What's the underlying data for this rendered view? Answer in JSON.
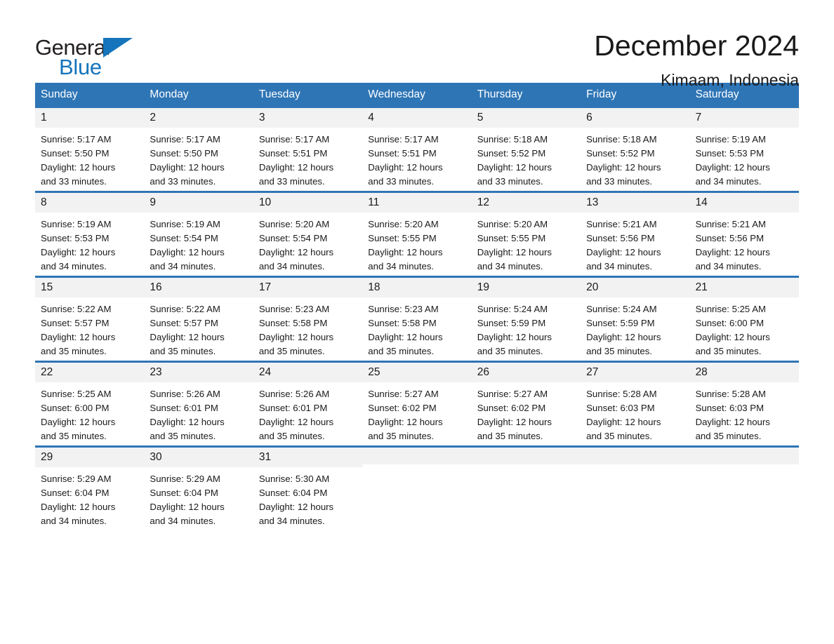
{
  "logo": {
    "word_one": "General",
    "word_two": "Blue",
    "triangle_color": "#1574bb",
    "text_color": "#231f20"
  },
  "header": {
    "title": "December 2024",
    "subtitle": "Kimaam, Indonesia"
  },
  "theme": {
    "header_blue": "#2e75b6",
    "date_band": "#f2f2f2",
    "text": "#1a1a1a",
    "page_background": "#ffffff"
  },
  "calendar": {
    "weekday_headers": [
      "Sunday",
      "Monday",
      "Tuesday",
      "Wednesday",
      "Thursday",
      "Friday",
      "Saturday"
    ],
    "labels": {
      "sunrise": "Sunrise:",
      "sunset": "Sunset:",
      "daylight": "Daylight:"
    },
    "weeks": [
      [
        {
          "date": "1",
          "sunrise": "Sunrise: 5:17 AM",
          "sunset": "Sunset: 5:50 PM",
          "daylight_line1": "Daylight: 12 hours",
          "daylight_line2": "and 33 minutes."
        },
        {
          "date": "2",
          "sunrise": "Sunrise: 5:17 AM",
          "sunset": "Sunset: 5:50 PM",
          "daylight_line1": "Daylight: 12 hours",
          "daylight_line2": "and 33 minutes."
        },
        {
          "date": "3",
          "sunrise": "Sunrise: 5:17 AM",
          "sunset": "Sunset: 5:51 PM",
          "daylight_line1": "Daylight: 12 hours",
          "daylight_line2": "and 33 minutes."
        },
        {
          "date": "4",
          "sunrise": "Sunrise: 5:17 AM",
          "sunset": "Sunset: 5:51 PM",
          "daylight_line1": "Daylight: 12 hours",
          "daylight_line2": "and 33 minutes."
        },
        {
          "date": "5",
          "sunrise": "Sunrise: 5:18 AM",
          "sunset": "Sunset: 5:52 PM",
          "daylight_line1": "Daylight: 12 hours",
          "daylight_line2": "and 33 minutes."
        },
        {
          "date": "6",
          "sunrise": "Sunrise: 5:18 AM",
          "sunset": "Sunset: 5:52 PM",
          "daylight_line1": "Daylight: 12 hours",
          "daylight_line2": "and 33 minutes."
        },
        {
          "date": "7",
          "sunrise": "Sunrise: 5:19 AM",
          "sunset": "Sunset: 5:53 PM",
          "daylight_line1": "Daylight: 12 hours",
          "daylight_line2": "and 34 minutes."
        }
      ],
      [
        {
          "date": "8",
          "sunrise": "Sunrise: 5:19 AM",
          "sunset": "Sunset: 5:53 PM",
          "daylight_line1": "Daylight: 12 hours",
          "daylight_line2": "and 34 minutes."
        },
        {
          "date": "9",
          "sunrise": "Sunrise: 5:19 AM",
          "sunset": "Sunset: 5:54 PM",
          "daylight_line1": "Daylight: 12 hours",
          "daylight_line2": "and 34 minutes."
        },
        {
          "date": "10",
          "sunrise": "Sunrise: 5:20 AM",
          "sunset": "Sunset: 5:54 PM",
          "daylight_line1": "Daylight: 12 hours",
          "daylight_line2": "and 34 minutes."
        },
        {
          "date": "11",
          "sunrise": "Sunrise: 5:20 AM",
          "sunset": "Sunset: 5:55 PM",
          "daylight_line1": "Daylight: 12 hours",
          "daylight_line2": "and 34 minutes."
        },
        {
          "date": "12",
          "sunrise": "Sunrise: 5:20 AM",
          "sunset": "Sunset: 5:55 PM",
          "daylight_line1": "Daylight: 12 hours",
          "daylight_line2": "and 34 minutes."
        },
        {
          "date": "13",
          "sunrise": "Sunrise: 5:21 AM",
          "sunset": "Sunset: 5:56 PM",
          "daylight_line1": "Daylight: 12 hours",
          "daylight_line2": "and 34 minutes."
        },
        {
          "date": "14",
          "sunrise": "Sunrise: 5:21 AM",
          "sunset": "Sunset: 5:56 PM",
          "daylight_line1": "Daylight: 12 hours",
          "daylight_line2": "and 34 minutes."
        }
      ],
      [
        {
          "date": "15",
          "sunrise": "Sunrise: 5:22 AM",
          "sunset": "Sunset: 5:57 PM",
          "daylight_line1": "Daylight: 12 hours",
          "daylight_line2": "and 35 minutes."
        },
        {
          "date": "16",
          "sunrise": "Sunrise: 5:22 AM",
          "sunset": "Sunset: 5:57 PM",
          "daylight_line1": "Daylight: 12 hours",
          "daylight_line2": "and 35 minutes."
        },
        {
          "date": "17",
          "sunrise": "Sunrise: 5:23 AM",
          "sunset": "Sunset: 5:58 PM",
          "daylight_line1": "Daylight: 12 hours",
          "daylight_line2": "and 35 minutes."
        },
        {
          "date": "18",
          "sunrise": "Sunrise: 5:23 AM",
          "sunset": "Sunset: 5:58 PM",
          "daylight_line1": "Daylight: 12 hours",
          "daylight_line2": "and 35 minutes."
        },
        {
          "date": "19",
          "sunrise": "Sunrise: 5:24 AM",
          "sunset": "Sunset: 5:59 PM",
          "daylight_line1": "Daylight: 12 hours",
          "daylight_line2": "and 35 minutes."
        },
        {
          "date": "20",
          "sunrise": "Sunrise: 5:24 AM",
          "sunset": "Sunset: 5:59 PM",
          "daylight_line1": "Daylight: 12 hours",
          "daylight_line2": "and 35 minutes."
        },
        {
          "date": "21",
          "sunrise": "Sunrise: 5:25 AM",
          "sunset": "Sunset: 6:00 PM",
          "daylight_line1": "Daylight: 12 hours",
          "daylight_line2": "and 35 minutes."
        }
      ],
      [
        {
          "date": "22",
          "sunrise": "Sunrise: 5:25 AM",
          "sunset": "Sunset: 6:00 PM",
          "daylight_line1": "Daylight: 12 hours",
          "daylight_line2": "and 35 minutes."
        },
        {
          "date": "23",
          "sunrise": "Sunrise: 5:26 AM",
          "sunset": "Sunset: 6:01 PM",
          "daylight_line1": "Daylight: 12 hours",
          "daylight_line2": "and 35 minutes."
        },
        {
          "date": "24",
          "sunrise": "Sunrise: 5:26 AM",
          "sunset": "Sunset: 6:01 PM",
          "daylight_line1": "Daylight: 12 hours",
          "daylight_line2": "and 35 minutes."
        },
        {
          "date": "25",
          "sunrise": "Sunrise: 5:27 AM",
          "sunset": "Sunset: 6:02 PM",
          "daylight_line1": "Daylight: 12 hours",
          "daylight_line2": "and 35 minutes."
        },
        {
          "date": "26",
          "sunrise": "Sunrise: 5:27 AM",
          "sunset": "Sunset: 6:02 PM",
          "daylight_line1": "Daylight: 12 hours",
          "daylight_line2": "and 35 minutes."
        },
        {
          "date": "27",
          "sunrise": "Sunrise: 5:28 AM",
          "sunset": "Sunset: 6:03 PM",
          "daylight_line1": "Daylight: 12 hours",
          "daylight_line2": "and 35 minutes."
        },
        {
          "date": "28",
          "sunrise": "Sunrise: 5:28 AM",
          "sunset": "Sunset: 6:03 PM",
          "daylight_line1": "Daylight: 12 hours",
          "daylight_line2": "and 35 minutes."
        }
      ],
      [
        {
          "date": "29",
          "sunrise": "Sunrise: 5:29 AM",
          "sunset": "Sunset: 6:04 PM",
          "daylight_line1": "Daylight: 12 hours",
          "daylight_line2": "and 34 minutes."
        },
        {
          "date": "30",
          "sunrise": "Sunrise: 5:29 AM",
          "sunset": "Sunset: 6:04 PM",
          "daylight_line1": "Daylight: 12 hours",
          "daylight_line2": "and 34 minutes."
        },
        {
          "date": "31",
          "sunrise": "Sunrise: 5:30 AM",
          "sunset": "Sunset: 6:04 PM",
          "daylight_line1": "Daylight: 12 hours",
          "daylight_line2": "and 34 minutes."
        },
        {
          "date": "",
          "sunrise": "",
          "sunset": "",
          "daylight_line1": "",
          "daylight_line2": ""
        },
        {
          "date": "",
          "sunrise": "",
          "sunset": "",
          "daylight_line1": "",
          "daylight_line2": ""
        },
        {
          "date": "",
          "sunrise": "",
          "sunset": "",
          "daylight_line1": "",
          "daylight_line2": ""
        },
        {
          "date": "",
          "sunrise": "",
          "sunset": "",
          "daylight_line1": "",
          "daylight_line2": ""
        }
      ]
    ]
  }
}
